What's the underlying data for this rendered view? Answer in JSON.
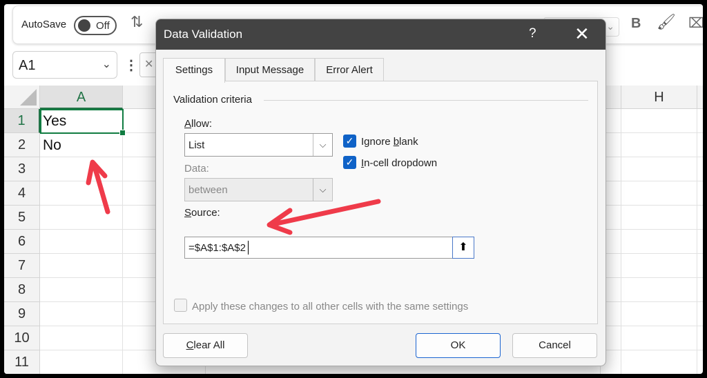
{
  "ribbon": {
    "autosave_label": "AutoSave",
    "autosave_state": "Off",
    "bold_label": "B"
  },
  "formula_bar": {
    "name_box": "A1"
  },
  "grid": {
    "columns": [
      "A",
      "H"
    ],
    "rows": [
      "1",
      "2",
      "3",
      "4",
      "5",
      "6",
      "7",
      "8",
      "9",
      "10",
      "11"
    ],
    "cells": {
      "A1": "Yes",
      "A2": "No"
    }
  },
  "dialog": {
    "title": "Data Validation",
    "help": "?",
    "tabs": [
      "Settings",
      "Input Message",
      "Error Alert"
    ],
    "section_label": "Validation criteria",
    "allow_label_u": "A",
    "allow_label_rest": "llow:",
    "allow_value": "List",
    "data_label": "Data:",
    "data_value": "between",
    "ignore_blank_pre": "Ignore ",
    "ignore_blank_u": "b",
    "ignore_blank_post": "lank",
    "incell_u": "I",
    "incell_post": "n-cell dropdown",
    "source_label_u": "S",
    "source_label_rest": "ource:",
    "source_value": "=$A$1:$A$2",
    "apply_all_label": "Apply these changes to all other cells with the same settings",
    "clear_all_u": "C",
    "clear_all_rest": "lear All",
    "ok_label": "OK",
    "cancel_label": "Cancel"
  },
  "colors": {
    "accent": "#0f62c7",
    "excel_green": "#107c41",
    "annotation_arrow": "#ef3b4a"
  }
}
